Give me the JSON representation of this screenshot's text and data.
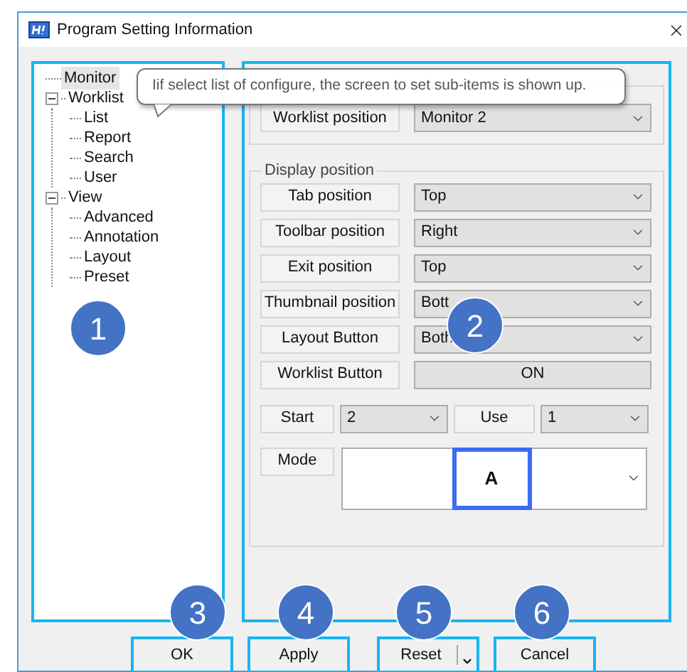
{
  "window": {
    "title": "Program Setting Information"
  },
  "tree": [
    {
      "label": "Monitor",
      "selected": true
    },
    {
      "label": "Worklist",
      "selected": false,
      "expanded": true,
      "children": [
        {
          "label": "List",
          "selected": false
        },
        {
          "label": "Report",
          "selected": false
        },
        {
          "label": "Search",
          "selected": false
        },
        {
          "label": "User",
          "selected": false
        }
      ]
    },
    {
      "label": "View",
      "selected": false,
      "expanded": true,
      "children": [
        {
          "label": "Advanced",
          "selected": false
        },
        {
          "label": "Annotation",
          "selected": false
        },
        {
          "label": "Layout",
          "selected": false
        },
        {
          "label": "Preset",
          "selected": false
        }
      ]
    }
  ],
  "tooltip": "Iif select list of configure, the screen to set sub-items is shown up.",
  "worklist_setting": {
    "rows": [
      {
        "kind": "select",
        "label": "Worklist position",
        "value": "Monitor 2"
      }
    ]
  },
  "display_position": {
    "title": "Display position",
    "rows": [
      {
        "kind": "select",
        "label": "Tab position",
        "value": "Top"
      },
      {
        "kind": "select",
        "label": "Toolbar position",
        "value": "Right"
      },
      {
        "kind": "select",
        "label": "Exit position",
        "value": "Top"
      },
      {
        "kind": "select",
        "label": "Thumbnail position",
        "value": "Bott"
      },
      {
        "kind": "select",
        "label": "Layout Button",
        "value": "Both"
      },
      {
        "kind": "toggle",
        "label": "Worklist Button",
        "value": "ON"
      }
    ],
    "start": {
      "label": "Start",
      "value": "2"
    },
    "use": {
      "label": "Use",
      "value": "1"
    },
    "mode": {
      "label": "Mode",
      "value": "A"
    }
  },
  "buttons": [
    {
      "label": "OK",
      "kind": "plain"
    },
    {
      "label": "Apply",
      "kind": "plain"
    },
    {
      "label": "Reset",
      "kind": "split"
    },
    {
      "label": "Cancel",
      "kind": "plain"
    }
  ],
  "markers": [
    "1",
    "2",
    "3",
    "4",
    "5",
    "6"
  ]
}
